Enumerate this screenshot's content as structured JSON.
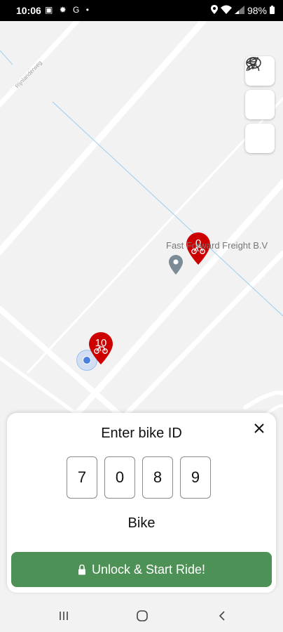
{
  "status_bar": {
    "time": "10:06",
    "left_icons": [
      "gallery-icon",
      "gear-icon",
      "google-icon",
      "dot-icon"
    ],
    "left_glyphs": "▣ ✹ G •",
    "battery": "98%"
  },
  "map": {
    "street_label": "Rijnlanderweg",
    "poi_label": "Fast Forward Freight B.V",
    "markers": [
      {
        "count": "0"
      },
      {
        "count": "10"
      }
    ]
  },
  "map_buttons": [
    {
      "icon": "profile-icon"
    },
    {
      "icon": "chat-icon"
    },
    {
      "icon": "navigate-icon"
    }
  ],
  "sheet": {
    "title": "Enter bike ID",
    "digits": [
      "7",
      "0",
      "8",
      "9"
    ],
    "subtitle": "Bike",
    "unlock_label": "Unlock & Start Ride!"
  },
  "colors": {
    "marker": "#cc0000",
    "unlock_button": "#4e9156",
    "location_dot": "#4a7fe0"
  }
}
